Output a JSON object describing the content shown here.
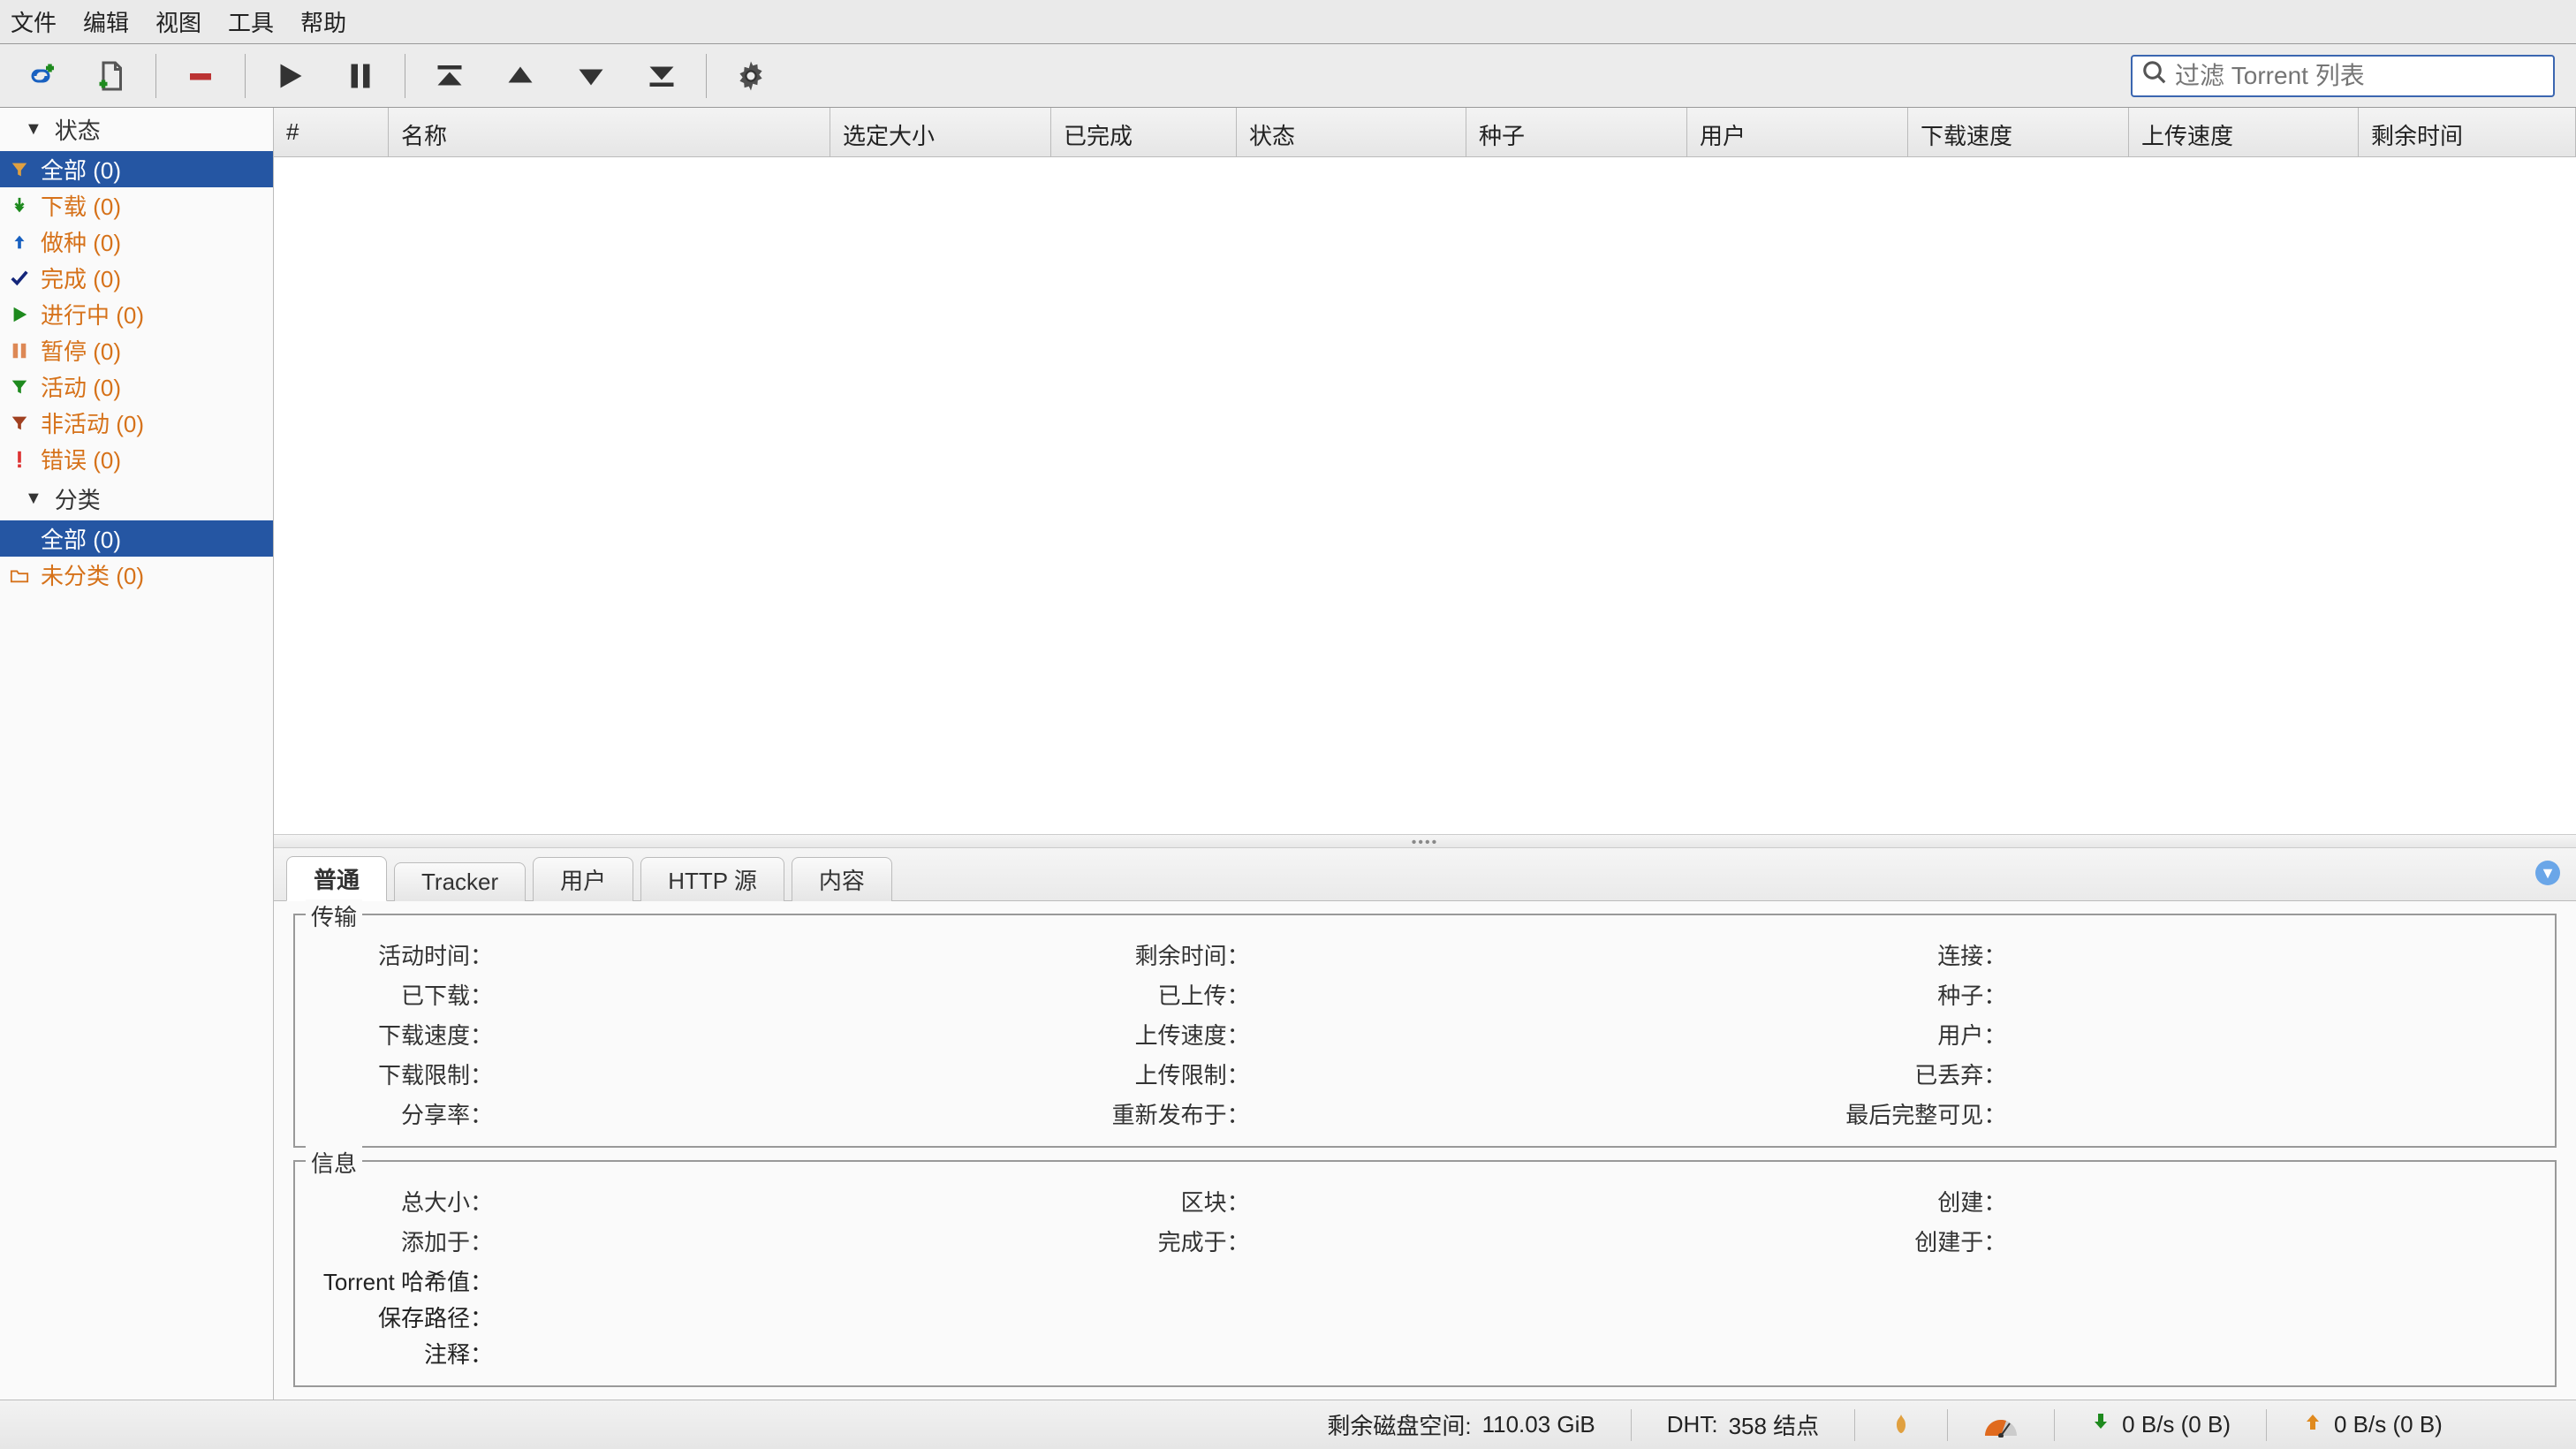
{
  "menu": {
    "items": [
      "文件",
      "编辑",
      "视图",
      "工具",
      "帮助"
    ]
  },
  "search": {
    "placeholder": "过滤 Torrent 列表"
  },
  "sidebar": {
    "section_status": "状态",
    "section_category": "分类",
    "status_items": [
      {
        "label": "全部 (0)"
      },
      {
        "label": "下载 (0)"
      },
      {
        "label": "做种 (0)"
      },
      {
        "label": "完成 (0)"
      },
      {
        "label": "进行中 (0)"
      },
      {
        "label": "暂停 (0)"
      },
      {
        "label": "活动 (0)"
      },
      {
        "label": "非活动 (0)"
      },
      {
        "label": "错误 (0)"
      }
    ],
    "category_items": [
      {
        "label": "全部 (0)"
      },
      {
        "label": "未分类 (0)"
      }
    ]
  },
  "columns": {
    "num": "#",
    "name": "名称",
    "size": "选定大小",
    "done": "已完成",
    "status": "状态",
    "seeds": "种子",
    "peers": "用户",
    "dlspeed": "下载速度",
    "upspeed": "上传速度",
    "eta": "剩余时间"
  },
  "tabs": {
    "general": "普通",
    "tracker": "Tracker",
    "peers": "用户",
    "http": "HTTP 源",
    "content": "内容"
  },
  "transfer_section": {
    "legend": "传输",
    "r1": {
      "a": "活动时间",
      "b": "剩余时间",
      "c": "连接"
    },
    "r2": {
      "a": "已下载",
      "b": "已上传",
      "c": "种子"
    },
    "r3": {
      "a": "下载速度",
      "b": "上传速度",
      "c": "用户"
    },
    "r4": {
      "a": "下载限制",
      "b": "上传限制",
      "c": "已丢弃"
    },
    "r5": {
      "a": "分享率",
      "b": "重新发布于",
      "c": "最后完整可见"
    }
  },
  "info_section": {
    "legend": "信息",
    "r1": {
      "a": "总大小",
      "b": "区块",
      "c": "创建"
    },
    "r2": {
      "a": "添加于",
      "b": "完成于",
      "c": "创建于"
    },
    "hash": "Torrent 哈希值",
    "path": "保存路径",
    "comment": "注释"
  },
  "statusbar": {
    "diskspace_label": "剩余磁盘空间:",
    "diskspace_value": "110.03 GiB",
    "dht_label": "DHT:",
    "dht_value": "358 结点",
    "dl": "0 B/s (0 B)",
    "ul": "0 B/s (0 B)"
  }
}
